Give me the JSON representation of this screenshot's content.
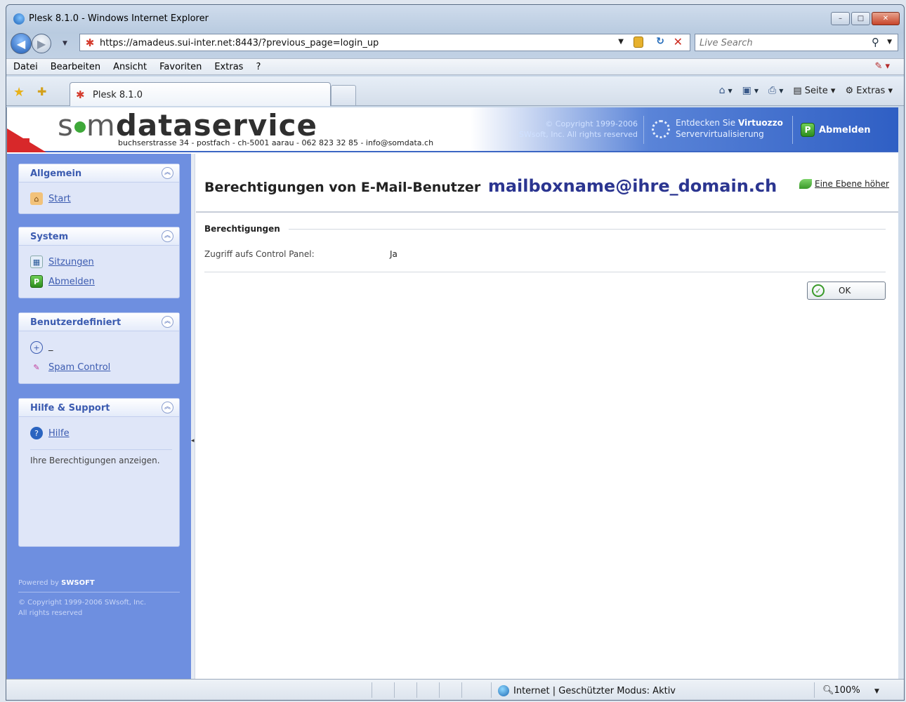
{
  "window": {
    "title": "Plesk 8.1.0 - Windows Internet Explorer",
    "minimize": "–",
    "maximize": "□",
    "close": "✕"
  },
  "address": {
    "url": "https://amadeus.sui-inter.net:8443/?previous_page=login_up",
    "search_placeholder": "Live Search"
  },
  "menu": [
    "Datei",
    "Bearbeiten",
    "Ansicht",
    "Favoriten",
    "Extras",
    "?"
  ],
  "tab": {
    "label": "Plesk 8.1.0"
  },
  "commandbar": {
    "page_label": "Seite",
    "tools_label": "Extras"
  },
  "header": {
    "logo_pre": "s",
    "logo_mid": "m",
    "logo_bold": "dataservice",
    "address_line": "buchserstrasse 34 - postfach - ch-5001 aarau - 062 823 32 85 - info@somdata.ch",
    "copyright_line1": "© Copyright 1999-2006",
    "copyright_line2": "SWsoft, Inc. All rights reserved",
    "virtuozzo_pre": "Entdecken Sie",
    "virtuozzo_bold": "Virtuozzo",
    "virtuozzo_line2": "Servervirtualisierung",
    "logout": "Abmelden"
  },
  "sidebar": {
    "groups": [
      {
        "title": "Allgemein",
        "items": [
          {
            "label": "Start",
            "icon": "home-icon"
          }
        ]
      },
      {
        "title": "System",
        "items": [
          {
            "label": "Sitzungen",
            "icon": "sessions-icon"
          },
          {
            "label": "Abmelden",
            "icon": "logout-icon"
          }
        ]
      },
      {
        "title": "Benutzerdefiniert",
        "items": [
          {
            "label": "_",
            "icon": "custom-button-icon"
          },
          {
            "label": "Spam Control",
            "icon": "spam-icon"
          }
        ]
      },
      {
        "title": "Hilfe & Support",
        "items": [
          {
            "label": "Hilfe",
            "icon": "help-icon"
          }
        ],
        "note": "Ihre Berechtigungen anzeigen."
      }
    ],
    "powered_by": "Powered by",
    "powered_brand": "SWSOFT",
    "copyright_line1": "© Copyright 1999-2006 SWsoft, Inc.",
    "copyright_line2": "All rights reserved"
  },
  "main": {
    "title": "Berechtigungen von E-Mail-Benutzer",
    "mailbox": "mailboxname@ihre_domain.ch",
    "up_level": "Eine Ebene höher",
    "section": "Berechtigungen",
    "rows": [
      {
        "label": "Zugriff aufs Control Panel:",
        "value": "Ja"
      }
    ],
    "ok_button": "OK"
  },
  "status": {
    "zone": "Internet | Geschützter Modus: Aktiv",
    "zoom": "100%"
  },
  "colors": {
    "sidebar": "#6e8fe0",
    "banner_blue": "#2f5fc4",
    "brand_red": "#d8282a",
    "brand_green": "#3ea839"
  }
}
